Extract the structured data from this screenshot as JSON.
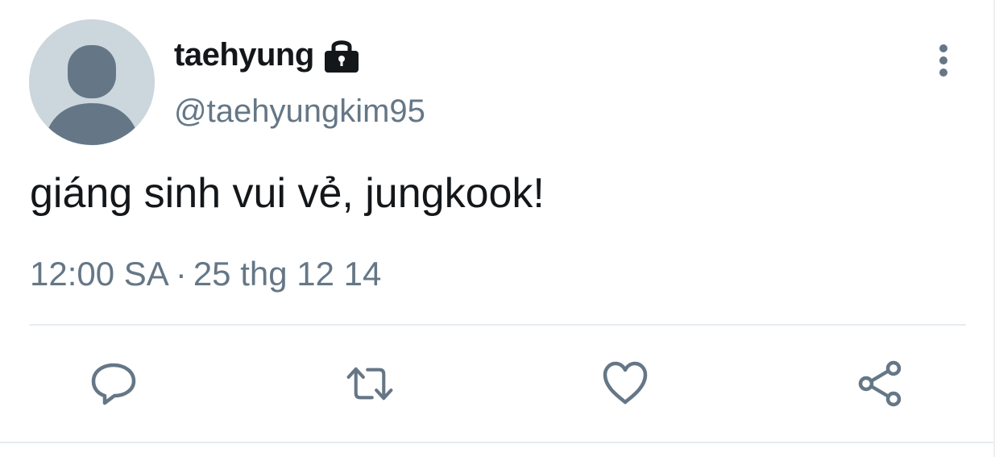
{
  "author": {
    "display_name": "taehyung",
    "handle": "@taehyungkim95",
    "protected_icon": "lock-icon",
    "avatar": "default-avatar"
  },
  "tweet": {
    "text": "giáng sinh vui vẻ, jungkook!",
    "time": "12:00 SA",
    "separator": "·",
    "date": "25 thg 12 14"
  },
  "actions": [
    {
      "name": "reply",
      "icon": "reply-icon"
    },
    {
      "name": "retweet",
      "icon": "retweet-icon"
    },
    {
      "name": "like",
      "icon": "heart-icon"
    },
    {
      "name": "share",
      "icon": "share-icon"
    }
  ],
  "menu": {
    "icon": "more-vertical-icon"
  },
  "colors": {
    "text_primary": "#14171a",
    "text_secondary": "#657786",
    "avatar_bg": "#ccd6dd",
    "avatar_fg": "#657786",
    "divider": "#e6ecf0"
  }
}
